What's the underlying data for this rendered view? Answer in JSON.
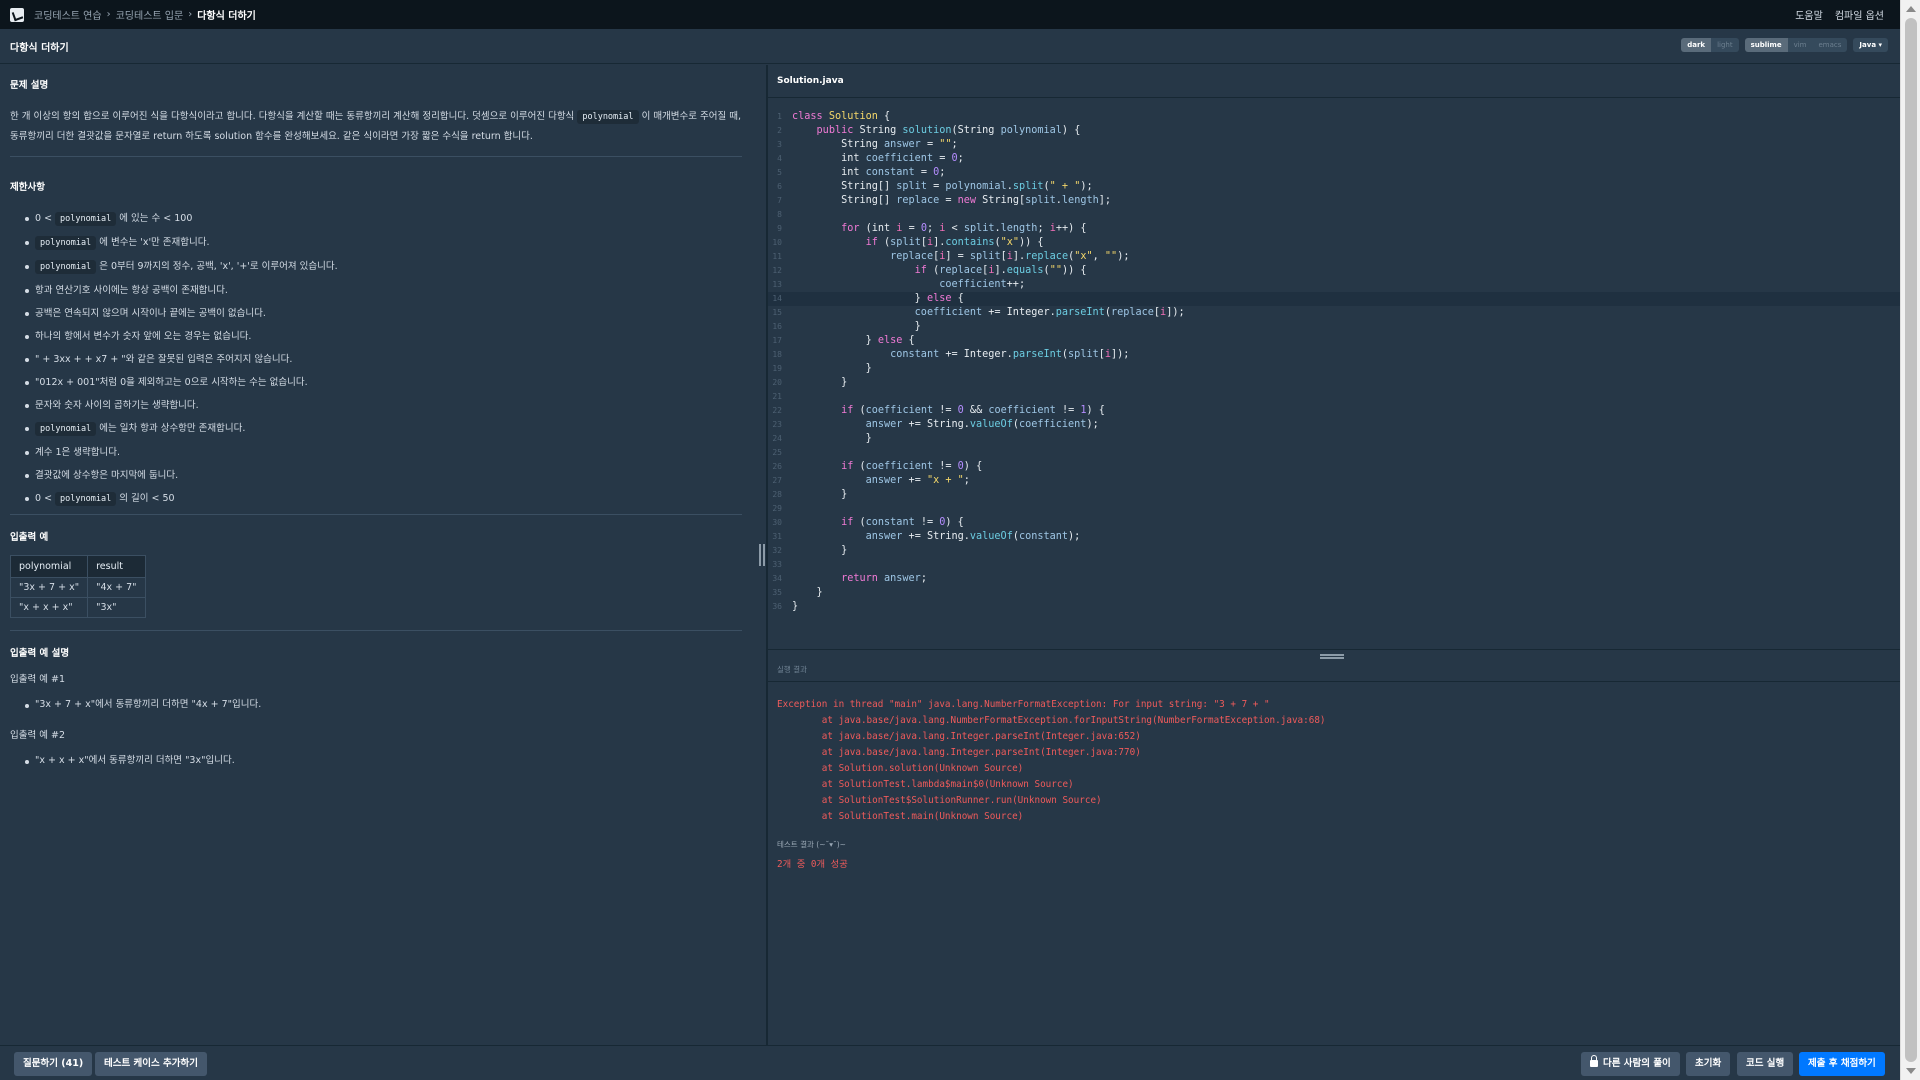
{
  "nav": {
    "crumbs": [
      "코딩테스트 연습",
      "코딩테스트 입문",
      "다항식 더하기"
    ],
    "help": "도움말",
    "compile_options": "컴파일 옵션"
  },
  "title": "다항식 더하기",
  "editor_toggles": {
    "theme": [
      "dark",
      "light"
    ],
    "keymap": [
      "sublime",
      "vim",
      "emacs"
    ],
    "language": "Java ▾"
  },
  "problem": {
    "heading": "문제 설명",
    "desc_before": "한 개 이상의 항의 합으로 이루어진 식을 다항식이라고 합니다. 다항식을 계산할 때는 동류항끼리 계산해 정리합니다. 덧셈으로 이루어진 다항식",
    "desc_code": "polynomial",
    "desc_after": "이 매개변수로 주어질 때, 동류항끼리 더한 결괏값을 문자열로 return 하도록 solution 함수를 완성해보세요. 같은 식이라면 가장 짧은 수식을 return 합니다."
  },
  "limits": {
    "heading": "제한사항",
    "items": [
      {
        "pre": "0 < ",
        "code": "polynomial",
        "post": " 에 있는 수 < 100"
      },
      {
        "pre": "",
        "code": "polynomial",
        "post": " 에 변수는 'x'만 존재합니다."
      },
      {
        "pre": "",
        "code": "polynomial",
        "post": " 은 0부터 9까지의 정수, 공백, 'x', '+'로 이루어져 있습니다."
      },
      {
        "pre": "항과 연산기호 사이에는 항상 공백이 존재합니다.",
        "code": "",
        "post": ""
      },
      {
        "pre": "공백은 연속되지 않으며 시작이나 끝에는 공백이 없습니다.",
        "code": "",
        "post": ""
      },
      {
        "pre": "하나의 항에서 변수가 숫자 앞에 오는 경우는 없습니다.",
        "code": "",
        "post": ""
      },
      {
        "pre": "\" + 3xx + + x7 + \"와 같은 잘못된 입력은 주어지지 않습니다.",
        "code": "",
        "post": ""
      },
      {
        "pre": "\"012x + 001\"처럼 0을 제외하고는 0으로 시작하는 수는 없습니다.",
        "code": "",
        "post": ""
      },
      {
        "pre": "문자와 숫자 사이의 곱하기는 생략합니다.",
        "code": "",
        "post": ""
      },
      {
        "pre": "",
        "code": "polynomial",
        "post": " 에는 일차 항과 상수항만 존재합니다."
      },
      {
        "pre": "계수 1은 생략합니다.",
        "code": "",
        "post": ""
      },
      {
        "pre": "결괏값에 상수항은 마지막에 둡니다.",
        "code": "",
        "post": ""
      },
      {
        "pre": "0 < ",
        "code": "polynomial",
        "post": " 의 길이 < 50"
      }
    ]
  },
  "io_example": {
    "heading": "입출력 예",
    "headers": [
      "polynomial",
      "result"
    ],
    "rows": [
      [
        "\"3x + 7 + x\"",
        "\"4x + 7\""
      ],
      [
        "\"x + x + x\"",
        "\"3x\""
      ]
    ]
  },
  "io_explain": {
    "heading": "입출력 예 설명",
    "examples": [
      {
        "label": "입출력 예 #1",
        "text": "\"3x + 7 + x\"에서 동류항끼리 더하면 \"4x + 7\"입니다."
      },
      {
        "label": "입출력 예 #2",
        "text": "\"x + x + x\"에서 동류항끼리 더하면 \"3x\"입니다."
      }
    ]
  },
  "editor": {
    "file_name": "Solution.java",
    "highlighted_line": 14,
    "lines": [
      [
        [
          "k",
          "class "
        ],
        [
          "cn",
          "Solution"
        ],
        [
          "ct",
          " {"
        ]
      ],
      [
        [
          "ct",
          "    "
        ],
        [
          "k",
          "public "
        ],
        [
          "ct",
          "String "
        ],
        [
          "fn",
          "solution"
        ],
        [
          "ct",
          "(String "
        ],
        [
          "pp",
          "polynomial"
        ],
        [
          "ct",
          ") {"
        ]
      ],
      [
        [
          "ct",
          "        String "
        ],
        [
          "pp",
          "answer"
        ],
        [
          "ct",
          " = "
        ],
        [
          "st",
          "\"\""
        ],
        [
          "ct",
          ";"
        ]
      ],
      [
        [
          "ct",
          "        int "
        ],
        [
          "pp",
          "coefficient"
        ],
        [
          "ct",
          " = "
        ],
        [
          "nm",
          "0"
        ],
        [
          "ct",
          ";"
        ]
      ],
      [
        [
          "ct",
          "        int "
        ],
        [
          "pp",
          "constant"
        ],
        [
          "ct",
          " = "
        ],
        [
          "nm",
          "0"
        ],
        [
          "ct",
          ";"
        ]
      ],
      [
        [
          "ct",
          "        String[] "
        ],
        [
          "pp",
          "split"
        ],
        [
          "ct",
          " = "
        ],
        [
          "pp",
          "polynomial"
        ],
        [
          "ct",
          "."
        ],
        [
          "fn",
          "split"
        ],
        [
          "ct",
          "("
        ],
        [
          "st",
          "\" + \""
        ],
        [
          "ct",
          ");"
        ]
      ],
      [
        [
          "ct",
          "        String[] "
        ],
        [
          "pp",
          "replace"
        ],
        [
          "ct",
          " = "
        ],
        [
          "k",
          "new "
        ],
        [
          "ct",
          "String["
        ],
        [
          "pp",
          "split"
        ],
        [
          "ct",
          "."
        ],
        [
          "pp",
          "length"
        ],
        [
          "ct",
          "];"
        ]
      ],
      [
        [
          "ct",
          ""
        ]
      ],
      [
        [
          "ct",
          "        "
        ],
        [
          "k",
          "for"
        ],
        [
          "ct",
          " (int "
        ],
        [
          "vr",
          "i"
        ],
        [
          "ct",
          " = "
        ],
        [
          "nm",
          "0"
        ],
        [
          "ct",
          "; "
        ],
        [
          "vr",
          "i"
        ],
        [
          "ct",
          " < "
        ],
        [
          "pp",
          "split"
        ],
        [
          "ct",
          "."
        ],
        [
          "pp",
          "length"
        ],
        [
          "ct",
          "; "
        ],
        [
          "vr",
          "i"
        ],
        [
          "ct",
          "++) {"
        ]
      ],
      [
        [
          "ct",
          "            "
        ],
        [
          "k",
          "if"
        ],
        [
          "ct",
          " ("
        ],
        [
          "pp",
          "split"
        ],
        [
          "ct",
          "["
        ],
        [
          "vr",
          "i"
        ],
        [
          "ct",
          "]."
        ],
        [
          "fn",
          "contains"
        ],
        [
          "ct",
          "("
        ],
        [
          "st",
          "\"x\""
        ],
        [
          "ct",
          ")) {"
        ]
      ],
      [
        [
          "ct",
          "                "
        ],
        [
          "pp",
          "replace"
        ],
        [
          "ct",
          "["
        ],
        [
          "vr",
          "i"
        ],
        [
          "ct",
          "] = "
        ],
        [
          "pp",
          "split"
        ],
        [
          "ct",
          "["
        ],
        [
          "vr",
          "i"
        ],
        [
          "ct",
          "]."
        ],
        [
          "fn",
          "replace"
        ],
        [
          "ct",
          "("
        ],
        [
          "st",
          "\"x\""
        ],
        [
          "ct",
          ", "
        ],
        [
          "st",
          "\"\""
        ],
        [
          "ct",
          ");"
        ]
      ],
      [
        [
          "ct",
          "                    "
        ],
        [
          "k",
          "if"
        ],
        [
          "ct",
          " ("
        ],
        [
          "pp",
          "replace"
        ],
        [
          "ct",
          "["
        ],
        [
          "vr",
          "i"
        ],
        [
          "ct",
          "]."
        ],
        [
          "fn",
          "equals"
        ],
        [
          "ct",
          "("
        ],
        [
          "st",
          "\"\""
        ],
        [
          "ct",
          ")) {"
        ]
      ],
      [
        [
          "ct",
          "                        "
        ],
        [
          "pp",
          "coefficient"
        ],
        [
          "ct",
          "++;"
        ]
      ],
      [
        [
          "ct",
          "                    } "
        ],
        [
          "k",
          "else"
        ],
        [
          "ct",
          " {"
        ]
      ],
      [
        [
          "ct",
          "                    "
        ],
        [
          "pp",
          "coefficient"
        ],
        [
          "ct",
          " += Integer."
        ],
        [
          "fn",
          "parseInt"
        ],
        [
          "ct",
          "("
        ],
        [
          "pp",
          "replace"
        ],
        [
          "ct",
          "["
        ],
        [
          "vr",
          "i"
        ],
        [
          "ct",
          "]);"
        ]
      ],
      [
        [
          "ct",
          "                    }"
        ]
      ],
      [
        [
          "ct",
          "            } "
        ],
        [
          "k",
          "else"
        ],
        [
          "ct",
          " {"
        ]
      ],
      [
        [
          "ct",
          "                "
        ],
        [
          "pp",
          "constant"
        ],
        [
          "ct",
          " += Integer."
        ],
        [
          "fn",
          "parseInt"
        ],
        [
          "ct",
          "("
        ],
        [
          "pp",
          "split"
        ],
        [
          "ct",
          "["
        ],
        [
          "vr",
          "i"
        ],
        [
          "ct",
          "]);"
        ]
      ],
      [
        [
          "ct",
          "            }"
        ]
      ],
      [
        [
          "ct",
          "        }"
        ]
      ],
      [
        [
          "ct",
          ""
        ]
      ],
      [
        [
          "ct",
          "        "
        ],
        [
          "k",
          "if"
        ],
        [
          "ct",
          " ("
        ],
        [
          "pp",
          "coefficient"
        ],
        [
          "ct",
          " != "
        ],
        [
          "nm",
          "0"
        ],
        [
          "ct",
          " && "
        ],
        [
          "pp",
          "coefficient"
        ],
        [
          "ct",
          " != "
        ],
        [
          "nm",
          "1"
        ],
        [
          "ct",
          ") {"
        ]
      ],
      [
        [
          "ct",
          "            "
        ],
        [
          "pp",
          "answer"
        ],
        [
          "ct",
          " += String."
        ],
        [
          "fn",
          "valueOf"
        ],
        [
          "ct",
          "("
        ],
        [
          "pp",
          "coefficient"
        ],
        [
          "ct",
          ");"
        ]
      ],
      [
        [
          "ct",
          "            }"
        ]
      ],
      [
        [
          "ct",
          ""
        ]
      ],
      [
        [
          "ct",
          "        "
        ],
        [
          "k",
          "if"
        ],
        [
          "ct",
          " ("
        ],
        [
          "pp",
          "coefficient"
        ],
        [
          "ct",
          " != "
        ],
        [
          "nm",
          "0"
        ],
        [
          "ct",
          ") {"
        ]
      ],
      [
        [
          "ct",
          "            "
        ],
        [
          "pp",
          "answer"
        ],
        [
          "ct",
          " += "
        ],
        [
          "st",
          "\"x + \""
        ],
        [
          "ct",
          ";"
        ]
      ],
      [
        [
          "ct",
          "        }"
        ]
      ],
      [
        [
          "ct",
          ""
        ]
      ],
      [
        [
          "ct",
          "        "
        ],
        [
          "k",
          "if"
        ],
        [
          "ct",
          " ("
        ],
        [
          "pp",
          "constant"
        ],
        [
          "ct",
          " != "
        ],
        [
          "nm",
          "0"
        ],
        [
          "ct",
          ") {"
        ]
      ],
      [
        [
          "ct",
          "            "
        ],
        [
          "pp",
          "answer"
        ],
        [
          "ct",
          " += String."
        ],
        [
          "fn",
          "valueOf"
        ],
        [
          "ct",
          "("
        ],
        [
          "pp",
          "constant"
        ],
        [
          "ct",
          ");"
        ]
      ],
      [
        [
          "ct",
          "        }"
        ]
      ],
      [
        [
          "ct",
          ""
        ]
      ],
      [
        [
          "ct",
          "        "
        ],
        [
          "k",
          "return "
        ],
        [
          "pp",
          "answer"
        ],
        [
          "ct",
          ";"
        ]
      ],
      [
        [
          "ct",
          "    }"
        ]
      ],
      [
        [
          "ct",
          "}"
        ]
      ]
    ]
  },
  "output": {
    "label": "실행 결과",
    "error_lines": [
      "Exception in thread \"main\" java.lang.NumberFormatException: For input string: \"3 + 7 + \"",
      "        at java.base/java.lang.NumberFormatException.forInputString(NumberFormatException.java:68)",
      "        at java.base/java.lang.Integer.parseInt(Integer.java:652)",
      "        at java.base/java.lang.Integer.parseInt(Integer.java:770)",
      "        at Solution.solution(Unknown Source)",
      "        at SolutionTest.lambda$main$0(Unknown Source)",
      "        at SolutionTest$SolutionRunner.run(Unknown Source)",
      "        at SolutionTest.main(Unknown Source)"
    ],
    "test_label": "테스트 결과 (~˘▾˘)~",
    "test_result": "2개 중 0개 성공"
  },
  "bottom": {
    "ask": "질문하기 (41)",
    "add_testcase": "테스트 케이스 추가하기",
    "others_solution": "다른 사람의 풀이",
    "reset": "초기화",
    "run": "코드 실행",
    "submit": "제출 후 채점하기"
  },
  "colors": {
    "accent": "#0078ff",
    "background": "#263747",
    "error": "#ef5b5b"
  }
}
